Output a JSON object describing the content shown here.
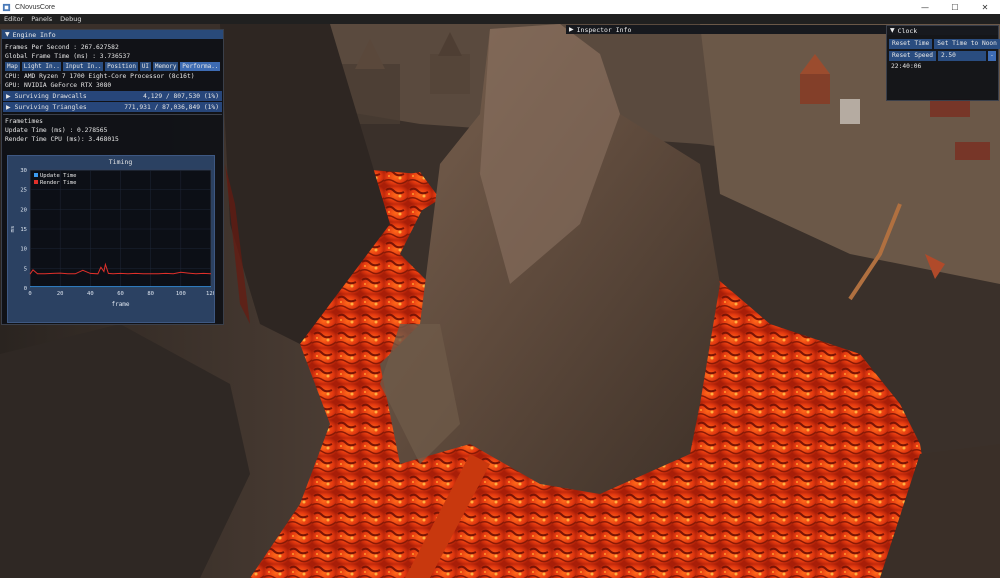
{
  "window": {
    "title": "CNovusCore",
    "minimize": "—",
    "maximize": "☐",
    "close": "✕"
  },
  "menu": [
    "Editor",
    "Panels",
    "Debug"
  ],
  "engine_info": {
    "title": "Engine Info",
    "fps_line": "Frames Per Second : 267.627582",
    "frametime_line": "Global Frame Time (ms) : 3.736537",
    "tabs": [
      "Map",
      "Light In..",
      "Input In..",
      "Position",
      "UI",
      "Memory",
      "Performa.."
    ],
    "active_tab": "Performa..",
    "cpu_line": "CPU: AMD Ryzen 7 1700 Eight-Core Processor (8c16t)",
    "gpu_line": "GPU: NVIDIA GeForce RTX 3080",
    "drawcalls_label": "Surviving Drawcalls",
    "drawcalls_value": "4,129 / 807,530 (1%)",
    "triangles_label": "Surviving Triangles",
    "triangles_value": "771,931 / 87,036,849 (1%)",
    "frametimes_header": "Frametimes",
    "update_line": "Update Time (ms) : 0.278565",
    "render_line": "Render Time CPU (ms): 3.468015"
  },
  "chart_data": {
    "type": "line",
    "title": "Timing",
    "xlabel": "frame",
    "ylabel": "ms",
    "xlim": [
      0,
      120
    ],
    "ylim": [
      0,
      30
    ],
    "xticks": [
      0,
      20,
      40,
      60,
      80,
      100,
      120
    ],
    "yticks": [
      0,
      5,
      10,
      15,
      20,
      25,
      30
    ],
    "colors": {
      "Update Time": "#3b9bf0",
      "Render Time": "#e0302a"
    },
    "series": [
      {
        "name": "Update Time",
        "x": [
          0,
          20,
          40,
          60,
          80,
          100,
          120
        ],
        "y": [
          0.3,
          0.3,
          0.3,
          0.3,
          0.3,
          0.3,
          0.3
        ]
      },
      {
        "name": "Render Time",
        "x": [
          0,
          2,
          5,
          10,
          15,
          20,
          25,
          30,
          35,
          40,
          45,
          47,
          49,
          50,
          52,
          55,
          60,
          65,
          70,
          75,
          80,
          85,
          90,
          95,
          100,
          105,
          110,
          115,
          120
        ],
        "y": [
          3.5,
          4.6,
          3.6,
          3.6,
          3.7,
          3.8,
          3.6,
          3.6,
          4.5,
          3.7,
          3.6,
          5.3,
          4.2,
          6.0,
          3.7,
          3.6,
          3.7,
          3.6,
          3.7,
          3.6,
          3.6,
          3.6,
          3.7,
          3.6,
          4.0,
          3.8,
          3.6,
          3.7,
          3.6
        ]
      }
    ]
  },
  "inspector": {
    "title": "Inspector Info"
  },
  "clock": {
    "title": "Clock",
    "reset_time": "Reset Time",
    "set_noon": "Set Time to Noon",
    "reset_speed": "Reset Speed",
    "speed_value": "2.50",
    "minus": "-",
    "time": "22:40:06"
  }
}
